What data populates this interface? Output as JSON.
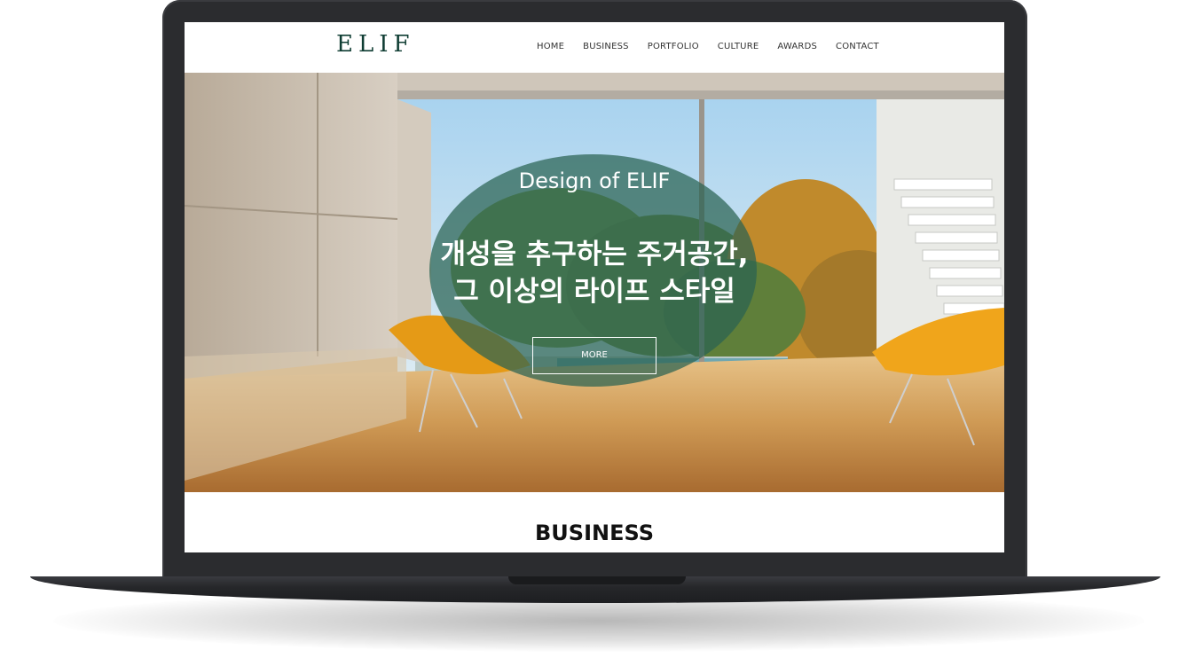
{
  "site": {
    "logo": "ELIF",
    "nav": [
      "HOME",
      "BUSINESS",
      "PORTFOLIO",
      "CULTURE",
      "AWARDS",
      "CONTACT"
    ]
  },
  "hero": {
    "subtitle": "Design of ELIF",
    "title_line1": "개성을 추구하는 주거공간,",
    "title_line2": "그 이상의 라이프 스타일",
    "button": "MORE"
  },
  "section": {
    "title": "BUSINESS"
  },
  "colors": {
    "brand": "#0f3d33",
    "overlay": "#2a6252",
    "laptop": "#2b2c2f"
  }
}
